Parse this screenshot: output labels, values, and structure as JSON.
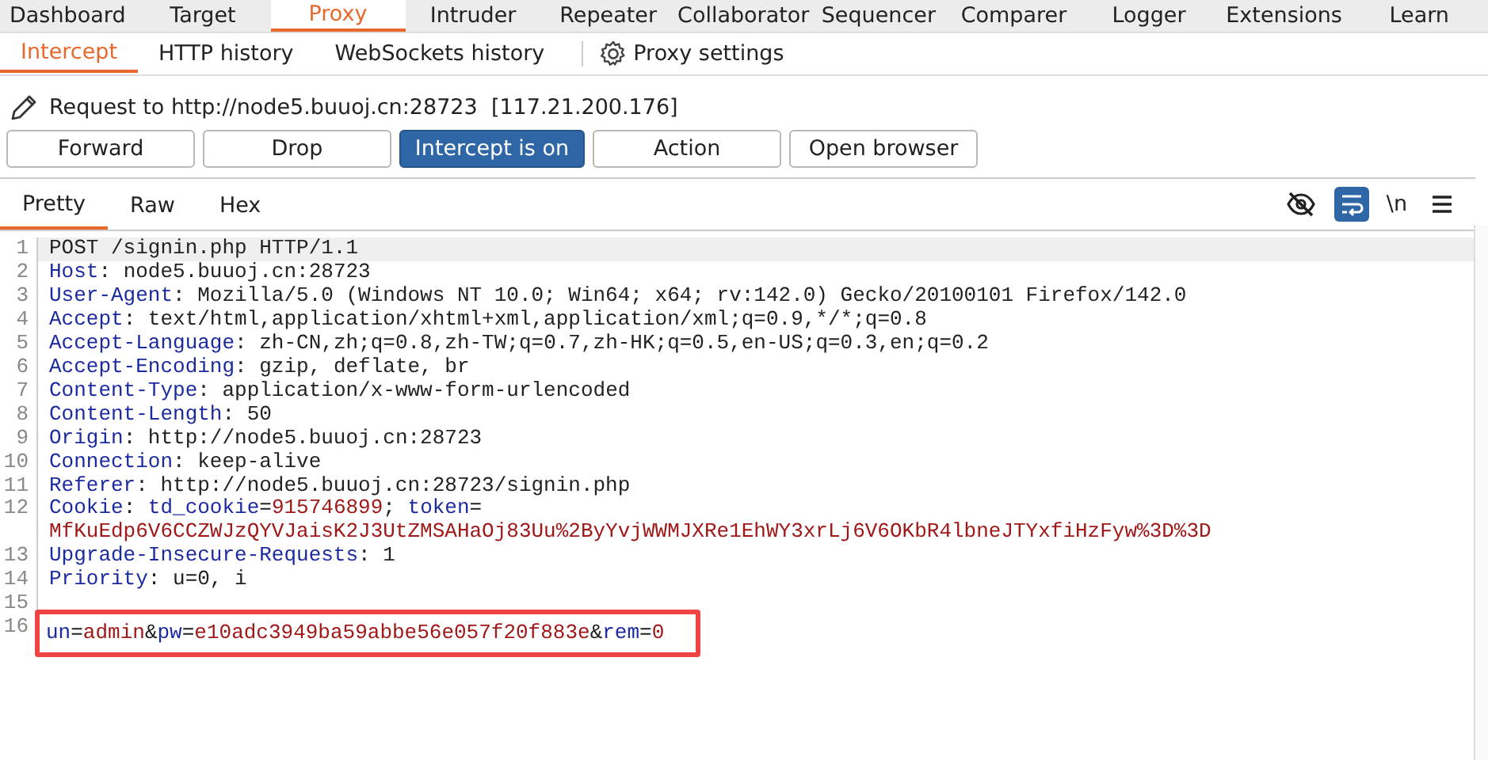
{
  "main_tabs": [
    {
      "label": "Dashboard",
      "selected": false
    },
    {
      "label": "Target",
      "selected": false
    },
    {
      "label": "Proxy",
      "selected": true
    },
    {
      "label": "Intruder",
      "selected": false
    },
    {
      "label": "Repeater",
      "selected": false
    },
    {
      "label": "Collaborator",
      "selected": false
    },
    {
      "label": "Sequencer",
      "selected": false
    },
    {
      "label": "Comparer",
      "selected": false
    },
    {
      "label": "Logger",
      "selected": false
    },
    {
      "label": "Extensions",
      "selected": false
    },
    {
      "label": "Learn",
      "selected": false
    }
  ],
  "sub_tabs": [
    {
      "label": "Intercept",
      "selected": true
    },
    {
      "label": "HTTP history",
      "selected": false
    },
    {
      "label": "WebSockets history",
      "selected": false
    }
  ],
  "settings_link": "Proxy settings",
  "request_info": "Request to http://node5.buuoj.cn:28723  [117.21.200.176]",
  "buttons": [
    {
      "label": "Forward",
      "on": false
    },
    {
      "label": "Drop",
      "on": false
    },
    {
      "label": "Intercept is on",
      "on": true
    },
    {
      "label": "Action",
      "on": false
    },
    {
      "label": "Open browser",
      "on": false
    }
  ],
  "editor_tabs": [
    {
      "label": "Pretty",
      "selected": true
    },
    {
      "label": "Raw",
      "selected": false
    },
    {
      "label": "Hex",
      "selected": false
    }
  ],
  "editor_tools": [
    {
      "kind": "eye",
      "on": false
    },
    {
      "kind": "wrap",
      "on": true
    },
    {
      "kind": "text",
      "label": "\\n",
      "on": false
    },
    {
      "kind": "menu",
      "on": false
    }
  ],
  "lines": [
    {
      "number": "1",
      "current": true,
      "highlighted": false,
      "segments": [
        {
          "kind": "plain",
          "text": "POST /signin.php HTTP/1.1"
        }
      ]
    },
    {
      "number": "2",
      "current": false,
      "highlighted": false,
      "segments": [
        {
          "kind": "key",
          "text": "Host"
        },
        {
          "kind": "plain",
          "text": ": node5.buuoj.cn:28723"
        }
      ]
    },
    {
      "number": "3",
      "current": false,
      "highlighted": false,
      "segments": [
        {
          "kind": "key",
          "text": "User-Agent"
        },
        {
          "kind": "plain",
          "text": ": Mozilla/5.0 (Windows NT 10.0; Win64; x64; rv:142.0) Gecko/20100101 Firefox/142.0"
        }
      ]
    },
    {
      "number": "4",
      "current": false,
      "highlighted": false,
      "segments": [
        {
          "kind": "key",
          "text": "Accept"
        },
        {
          "kind": "plain",
          "text": ": text/html,application/xhtml+xml,application/xml;q=0.9,*/*;q=0.8"
        }
      ]
    },
    {
      "number": "5",
      "current": false,
      "highlighted": false,
      "segments": [
        {
          "kind": "key",
          "text": "Accept-Language"
        },
        {
          "kind": "plain",
          "text": ": zh-CN,zh;q=0.8,zh-TW;q=0.7,zh-HK;q=0.5,en-US;q=0.3,en;q=0.2"
        }
      ]
    },
    {
      "number": "6",
      "current": false,
      "highlighted": false,
      "segments": [
        {
          "kind": "key",
          "text": "Accept-Encoding"
        },
        {
          "kind": "plain",
          "text": ": gzip, deflate, br"
        }
      ]
    },
    {
      "number": "7",
      "current": false,
      "highlighted": false,
      "segments": [
        {
          "kind": "key",
          "text": "Content-Type"
        },
        {
          "kind": "plain",
          "text": ": application/x-www-form-urlencoded"
        }
      ]
    },
    {
      "number": "8",
      "current": false,
      "highlighted": false,
      "segments": [
        {
          "kind": "key",
          "text": "Content-Length"
        },
        {
          "kind": "plain",
          "text": ": 50"
        }
      ]
    },
    {
      "number": "9",
      "current": false,
      "highlighted": false,
      "segments": [
        {
          "kind": "key",
          "text": "Origin"
        },
        {
          "kind": "plain",
          "text": ": http://node5.buuoj.cn:28723"
        }
      ]
    },
    {
      "number": "10",
      "current": false,
      "highlighted": false,
      "segments": [
        {
          "kind": "key",
          "text": "Connection"
        },
        {
          "kind": "plain",
          "text": ": keep-alive"
        }
      ]
    },
    {
      "number": "11",
      "current": false,
      "highlighted": false,
      "segments": [
        {
          "kind": "key",
          "text": "Referer"
        },
        {
          "kind": "plain",
          "text": ": http://node5.buuoj.cn:28723/signin.php"
        }
      ]
    },
    {
      "number": "12",
      "current": false,
      "highlighted": false,
      "segments": [
        {
          "kind": "key",
          "text": "Cookie"
        },
        {
          "kind": "plain",
          "text": ": "
        },
        {
          "kind": "key",
          "text": "td_cookie"
        },
        {
          "kind": "plain",
          "text": "="
        },
        {
          "kind": "value",
          "text": "915746899"
        },
        {
          "kind": "plain",
          "text": "; "
        },
        {
          "kind": "key",
          "text": "token"
        },
        {
          "kind": "plain",
          "text": "= "
        },
        {
          "kind": "value",
          "text": "MfKuEdp6V6CCZWJzQYVJaisK2J3UtZMSAHaOj83Uu%2ByYvjWWMJXRe1EhWY3xrLj6V6OKbR4lbneJTYxfiHzFyw%3D%3D"
        }
      ]
    },
    {
      "number": "13",
      "current": false,
      "highlighted": false,
      "segments": [
        {
          "kind": "key",
          "text": "Upgrade-Insecure-Requests"
        },
        {
          "kind": "plain",
          "text": ": 1"
        }
      ]
    },
    {
      "number": "14",
      "current": false,
      "highlighted": false,
      "segments": [
        {
          "kind": "key",
          "text": "Priority"
        },
        {
          "kind": "plain",
          "text": ": u=0, i"
        }
      ]
    },
    {
      "number": "15",
      "current": false,
      "highlighted": false
    },
    {
      "number": "16",
      "current": false,
      "highlighted": true,
      "segments": [
        {
          "kind": "key",
          "text": "un"
        },
        {
          "kind": "plain",
          "text": "="
        },
        {
          "kind": "value",
          "text": "admin"
        },
        {
          "kind": "plain",
          "text": "&"
        },
        {
          "kind": "key",
          "text": "pw"
        },
        {
          "kind": "plain",
          "text": "="
        },
        {
          "kind": "value",
          "text": "e10adc3949ba59abbe56e057f20f883e"
        },
        {
          "kind": "plain",
          "text": "&"
        },
        {
          "kind": "key",
          "text": "rem"
        },
        {
          "kind": "plain",
          "text": "="
        },
        {
          "kind": "value",
          "text": "0"
        }
      ]
    }
  ]
}
